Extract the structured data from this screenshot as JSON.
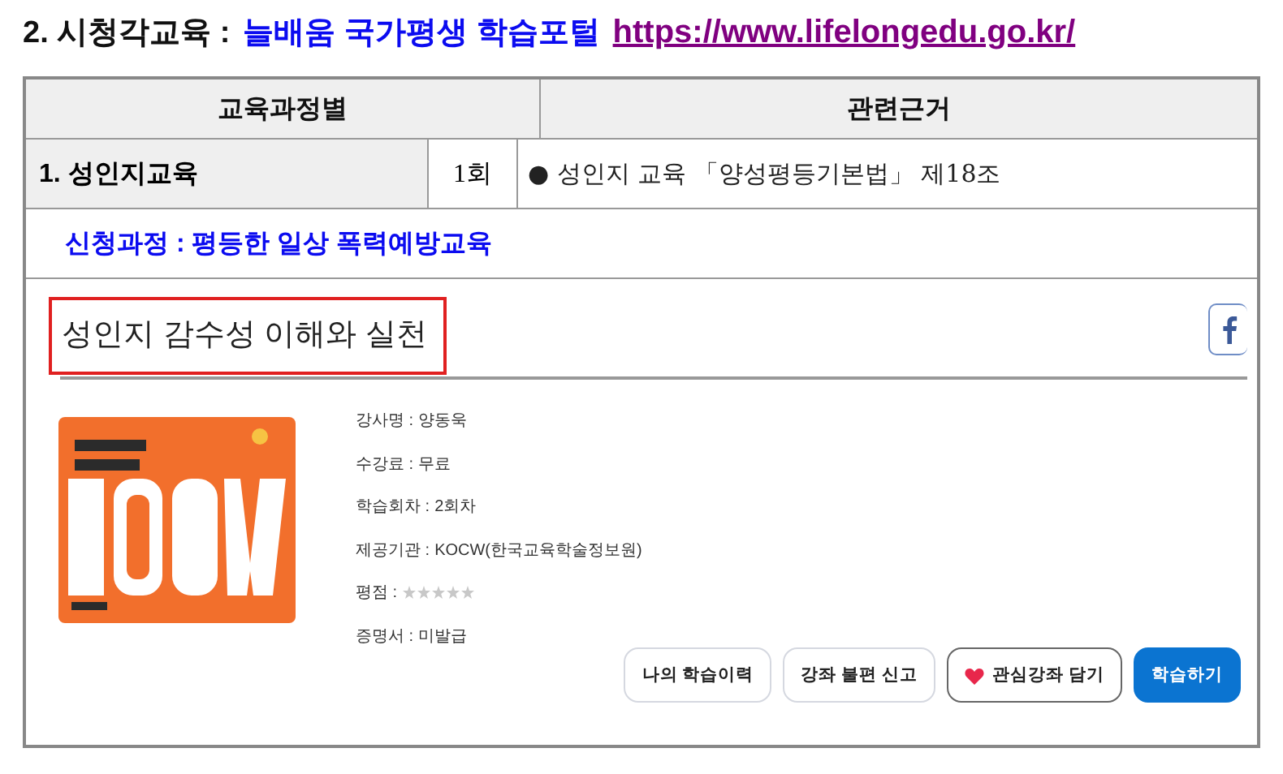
{
  "heading": {
    "label": "2.  시청각교육 :",
    "portal": "늘배움 국가평생 학습포털",
    "url": "https://www.lifelongedu.go.kr/"
  },
  "table": {
    "columns": [
      "교육과정별",
      "관련근거"
    ],
    "rows": [
      {
        "course": "1.  성인지교육",
        "count": "1회",
        "bullet": "●",
        "basis": "성인지 교육 「양성평등기본법」 제18조"
      }
    ]
  },
  "application": "신청과정 : 평등한 일상 폭력예방교육",
  "course_page": {
    "title": "성인지 감수성 이해와 실천",
    "details": [
      {
        "kind": "text",
        "label": "강사명 :",
        "value": "양동욱"
      },
      {
        "kind": "text",
        "label": "수강료 :",
        "value": "무료"
      },
      {
        "kind": "text",
        "label": "학습회차 :",
        "value": "2회차"
      },
      {
        "kind": "text",
        "label": "제공기관 :",
        "value": "KOCW(한국교육학술정보원)"
      },
      {
        "kind": "rating",
        "label": "평점 :",
        "stars": 0
      },
      {
        "kind": "text",
        "label": "증명서 :",
        "value": "미발급"
      }
    ],
    "buttons": [
      {
        "kind": "outline",
        "label": "나의 학습이력"
      },
      {
        "kind": "outline",
        "label": "강좌 불편 신고"
      },
      {
        "kind": "favorite",
        "label": "관심강좌 담기"
      },
      {
        "kind": "primary",
        "label": "학습하기"
      }
    ]
  }
}
